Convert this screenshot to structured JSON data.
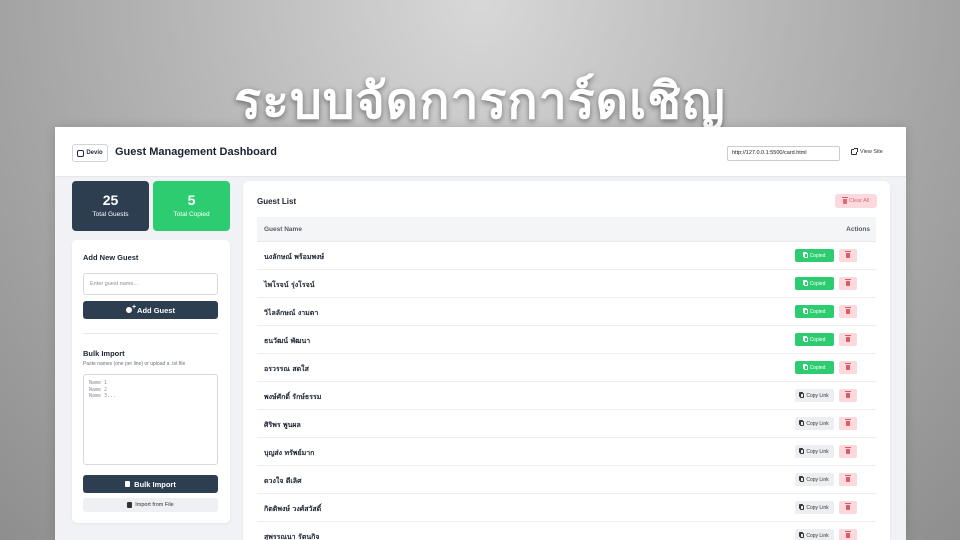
{
  "hero": {
    "title": "ระบบจัดการการ์ดเชิญ"
  },
  "header": {
    "logo_text": "Devio",
    "title": "Guest Management Dashboard",
    "url_value": "http://127.0.0.1:5500/card.html",
    "view_site_label": "View Site"
  },
  "stats": {
    "total_value": "25",
    "total_label": "Total Guests",
    "copied_value": "5",
    "copied_label": "Total Copied"
  },
  "add_guest": {
    "heading": "Add New Guest",
    "placeholder": "Enter guest name...",
    "button_label": "Add Guest"
  },
  "bulk": {
    "heading": "Bulk Import",
    "hint": "Paste names (one per line) or upload a .txt file",
    "placeholder": "Name 1\nName 2\nName 3...",
    "button_label": "Bulk Import",
    "file_button_label": "Import from File"
  },
  "guest_list": {
    "title": "Guest List",
    "clear_label": "Clear All",
    "col_name": "Guest Name",
    "col_actions": "Actions",
    "copied_label": "Copied",
    "copy_label": "Copy Link",
    "rows": [
      {
        "name": "นงลักษณ์ พร้อมพงษ์",
        "status": "copied"
      },
      {
        "name": "ไพโรจน์ รุ่งโรจน์",
        "status": "copied"
      },
      {
        "name": "วิไลลักษณ์ งามตา",
        "status": "copied"
      },
      {
        "name": "ธนวัฒน์ พัฒนา",
        "status": "copied"
      },
      {
        "name": "อรวรรณ สดใส",
        "status": "copied"
      },
      {
        "name": "พงษ์ศักดิ์ รักษ์ธรรม",
        "status": "copy"
      },
      {
        "name": "ศิริพร พูนผล",
        "status": "copy"
      },
      {
        "name": "บุญส่ง ทรัพย์มาก",
        "status": "copy"
      },
      {
        "name": "ดวงใจ ดีเลิศ",
        "status": "copy"
      },
      {
        "name": "กิตติพงษ์ วงศ์สวัสดิ์",
        "status": "copy"
      },
      {
        "name": "สุพรรณนา รัตนกิจ",
        "status": "copy"
      }
    ]
  },
  "colors": {
    "dark": "#2c3e50",
    "green": "#2ecc71",
    "danger_bg": "#fbd9dc",
    "danger": "#e05a64"
  }
}
